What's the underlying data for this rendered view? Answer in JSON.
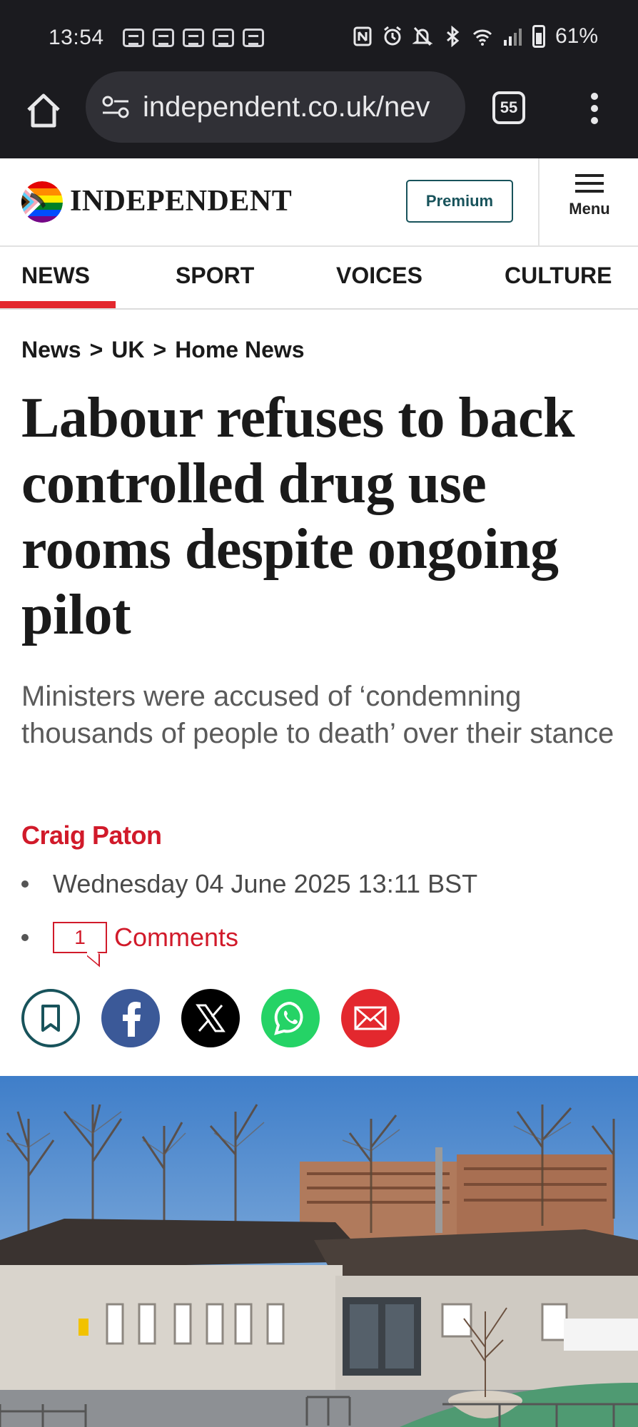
{
  "status_bar": {
    "time": "13:54",
    "battery_percent": "61%",
    "notification_icons": [
      "notification-icon",
      "notification-icon",
      "notification-icon",
      "notification-icon",
      "notification-icon"
    ],
    "right_icons": [
      "nfc-icon",
      "alarm-icon",
      "bell-off-icon",
      "bluetooth-icon",
      "wifi-icon",
      "signal-icon",
      "battery-icon"
    ]
  },
  "browser": {
    "url": "independent.co.uk/nev",
    "tab_count": "55"
  },
  "header": {
    "logo_text": "INDEPENDENT",
    "premium_label": "Premium",
    "menu_label": "Menu"
  },
  "nav": {
    "items": [
      {
        "label": "NEWS",
        "active": true
      },
      {
        "label": "SPORT",
        "active": false
      },
      {
        "label": "VOICES",
        "active": false
      },
      {
        "label": "CULTURE",
        "active": false
      }
    ],
    "active_color": "#e3282e"
  },
  "breadcrumb": {
    "items": [
      "News",
      "UK",
      "Home News"
    ],
    "separator": ">"
  },
  "article": {
    "headline": "Labour refuses to back controlled drug use rooms despite ongoing pilot",
    "standfirst": "Ministers were accused of ‘condemning thousands of people to death’ over their stance",
    "author": "Craig Paton",
    "date": "Wednesday 04 June 2025 13:11 BST",
    "comment_count": "1",
    "comments_label": "Comments"
  },
  "share": {
    "buttons": [
      "bookmark-icon",
      "facebook-icon",
      "x-icon",
      "whatsapp-icon",
      "email-icon"
    ],
    "colors": {
      "bookmark": "#18535b",
      "facebook": "#3b5998",
      "x": "#000000",
      "whatsapp": "#25d366",
      "email": "#e3282e"
    }
  },
  "colors": {
    "brand_red": "#d11a2a",
    "premium_teal": "#18535b",
    "chrome_dark": "#1b1b1f"
  }
}
